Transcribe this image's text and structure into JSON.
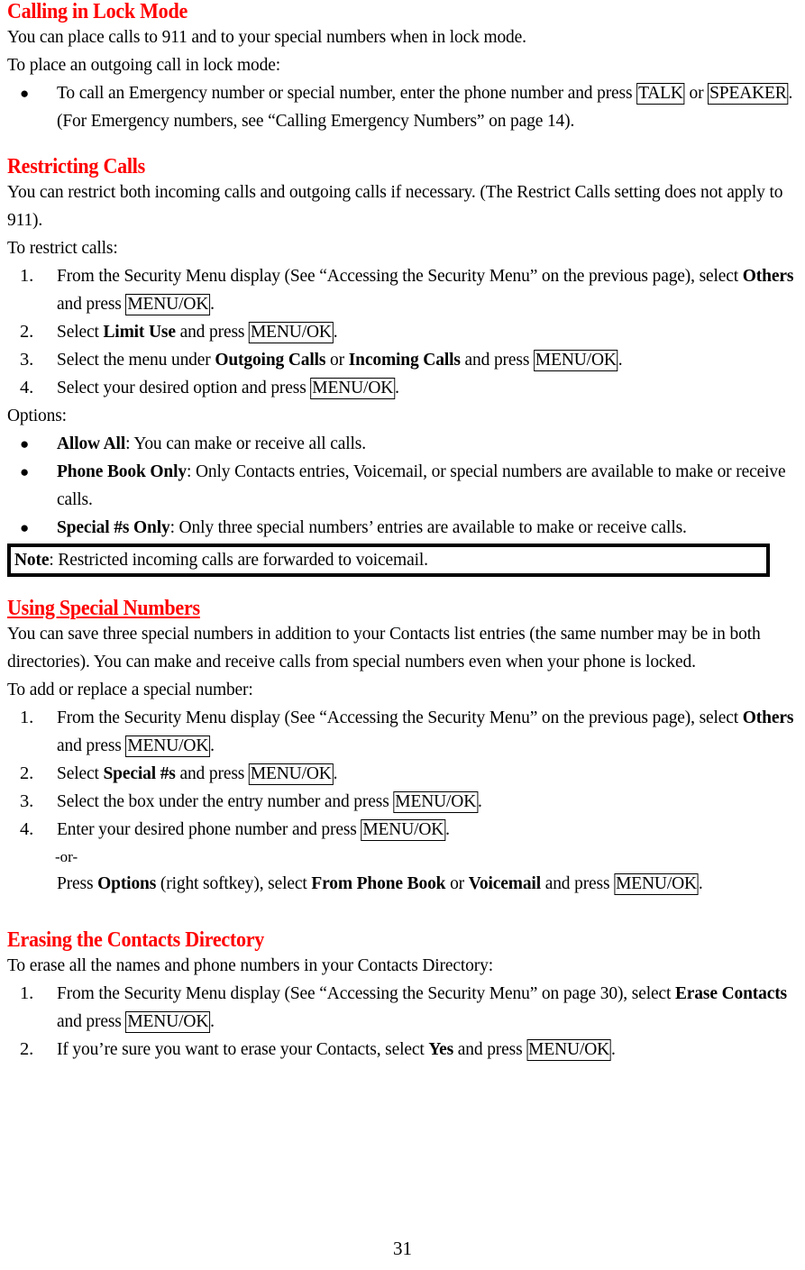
{
  "document": {
    "page_number": "31",
    "heading_color": "#ff0000",
    "text_color": "#000000"
  },
  "sections": [
    {
      "id": "calling-in-lock-mode",
      "heading": "Calling in Lock Mode",
      "underlined": false,
      "intro": [
        "You can place calls to 911 and to your special numbers when in lock mode.",
        "To place an outgoing call in lock mode:"
      ],
      "bullets": [
        {
          "marker": "●",
          "parts": [
            {
              "t": "To call an Emergency number or special number, enter the phone number and press ",
              "s": "plain"
            },
            {
              "t": "TALK",
              "s": "keycap"
            },
            {
              "t": " or ",
              "s": "plain"
            },
            {
              "t": "SPEAKER",
              "s": "keycap"
            },
            {
              "t": ". (For Emergency numbers, see “Calling Emergency Numbers” on page 14).",
              "s": "plain"
            }
          ]
        }
      ]
    },
    {
      "id": "restricting-calls",
      "heading": "Restricting Calls",
      "underlined": false,
      "intro": [
        "You can restrict both incoming calls and outgoing calls if necessary. (The Restrict Calls setting does not apply to 911).",
        "To restrict calls:"
      ],
      "steps": [
        {
          "marker": "1.",
          "parts": [
            {
              "t": "From the Security Menu display (See “Accessing the Security Menu” on the previous page), select ",
              "s": "plain"
            },
            {
              "t": "Others",
              "s": "bold"
            },
            {
              "t": " and press ",
              "s": "plain"
            },
            {
              "t": "MENU/OK",
              "s": "keycap"
            },
            {
              "t": ".",
              "s": "plain"
            }
          ]
        },
        {
          "marker": "2.",
          "parts": [
            {
              "t": "Select ",
              "s": "plain"
            },
            {
              "t": "Limit Use",
              "s": "bold"
            },
            {
              "t": " and press ",
              "s": "plain"
            },
            {
              "t": "MENU/OK",
              "s": "keycap"
            },
            {
              "t": ".",
              "s": "plain"
            }
          ]
        },
        {
          "marker": "3.",
          "parts": [
            {
              "t": "Select the menu under ",
              "s": "plain"
            },
            {
              "t": "Outgoing Calls",
              "s": "bold"
            },
            {
              "t": " or ",
              "s": "plain"
            },
            {
              "t": "Incoming Calls",
              "s": "bold"
            },
            {
              "t": " and press ",
              "s": "plain"
            },
            {
              "t": "MENU/OK",
              "s": "keycap"
            },
            {
              "t": ".",
              "s": "plain"
            }
          ]
        },
        {
          "marker": "4.",
          "parts": [
            {
              "t": "Select your desired option and press ",
              "s": "plain"
            },
            {
              "t": "MENU/OK",
              "s": "keycap"
            },
            {
              "t": ".",
              "s": "plain"
            }
          ]
        }
      ],
      "options_label": "Options:",
      "option_bullets": [
        {
          "marker": "●",
          "parts": [
            {
              "t": "Allow All",
              "s": "bold"
            },
            {
              "t": ": You can make or receive all calls.",
              "s": "plain"
            }
          ]
        },
        {
          "marker": "●",
          "parts": [
            {
              "t": "Phone Book Only",
              "s": "bold"
            },
            {
              "t": ": Only Contacts entries, Voicemail, or special numbers are available to make or receive calls.",
              "s": "plain"
            }
          ]
        },
        {
          "marker": "●",
          "parts": [
            {
              "t": "Special #s Only",
              "s": "bold"
            },
            {
              "t": ": Only three special numbers’ entries are available to make or receive calls.",
              "s": "plain"
            }
          ]
        }
      ],
      "note": {
        "label": "Note",
        "text": ": Restricted incoming calls are forwarded to voicemail."
      }
    },
    {
      "id": "using-special-numbers",
      "heading": "Using Special Numbers",
      "underlined": true,
      "intro": [
        "You can save three special numbers in addition to your Contacts list entries (the same number may be in both directories). You can make and receive calls from special numbers even when your phone is locked.",
        "To add or replace a special number:"
      ],
      "steps": [
        {
          "marker": "1.",
          "parts": [
            {
              "t": "From the Security Menu display (See “Accessing the Security Menu” on the previous page), select ",
              "s": "plain"
            },
            {
              "t": "Others",
              "s": "bold"
            },
            {
              "t": " and press ",
              "s": "plain"
            },
            {
              "t": "MENU/OK",
              "s": "keycap"
            },
            {
              "t": ".",
              "s": "plain"
            }
          ]
        },
        {
          "marker": "2.",
          "parts": [
            {
              "t": "Select ",
              "s": "plain"
            },
            {
              "t": "Special #s",
              "s": "bold"
            },
            {
              "t": " and press ",
              "s": "plain"
            },
            {
              "t": "MENU/OK",
              "s": "keycap"
            },
            {
              "t": ".",
              "s": "plain"
            }
          ]
        },
        {
          "marker": "3.",
          "parts": [
            {
              "t": "Select the box under the entry number and press ",
              "s": "plain"
            },
            {
              "t": "MENU/OK",
              "s": "keycap"
            },
            {
              "t": ".",
              "s": "plain"
            }
          ]
        },
        {
          "marker": "4.",
          "parts": [
            {
              "t": "Enter your desired phone number and press ",
              "s": "plain"
            },
            {
              "t": "MENU/OK",
              "s": "keycap"
            },
            {
              "t": ".",
              "s": "plain"
            }
          ]
        }
      ],
      "or_text": "-or-",
      "alt_line": [
        {
          "t": "Press ",
          "s": "plain"
        },
        {
          "t": "Options",
          "s": "bold"
        },
        {
          "t": " (right softkey), select ",
          "s": "plain"
        },
        {
          "t": "From Phone Book",
          "s": "bold"
        },
        {
          "t": " or ",
          "s": "plain"
        },
        {
          "t": "Voicemail",
          "s": "bold"
        },
        {
          "t": " and press ",
          "s": "plain"
        },
        {
          "t": "MENU/OK",
          "s": "keycap"
        },
        {
          "t": ".",
          "s": "plain"
        }
      ]
    },
    {
      "id": "erasing-the-contacts-directory",
      "heading": "Erasing the Contacts Directory",
      "underlined": false,
      "intro": [
        "To erase all the names and phone numbers in your Contacts Directory:"
      ],
      "steps": [
        {
          "marker": "1.",
          "parts": [
            {
              "t": "From the Security Menu display (See “Accessing the Security Menu” on page 30), select ",
              "s": "plain"
            },
            {
              "t": " Erase Contacts",
              "s": "bold"
            },
            {
              "t": " and press ",
              "s": "plain"
            },
            {
              "t": "MENU/OK",
              "s": "keycap"
            },
            {
              "t": ".",
              "s": "plain"
            }
          ]
        },
        {
          "marker": "2.",
          "parts": [
            {
              "t": "If you’re sure you want to erase your Contacts, select ",
              "s": "plain"
            },
            {
              "t": "Yes",
              "s": "bold"
            },
            {
              "t": " and press ",
              "s": "plain"
            },
            {
              "t": "MENU/OK",
              "s": "keycap"
            },
            {
              "t": ".",
              "s": "plain"
            }
          ]
        }
      ]
    }
  ]
}
